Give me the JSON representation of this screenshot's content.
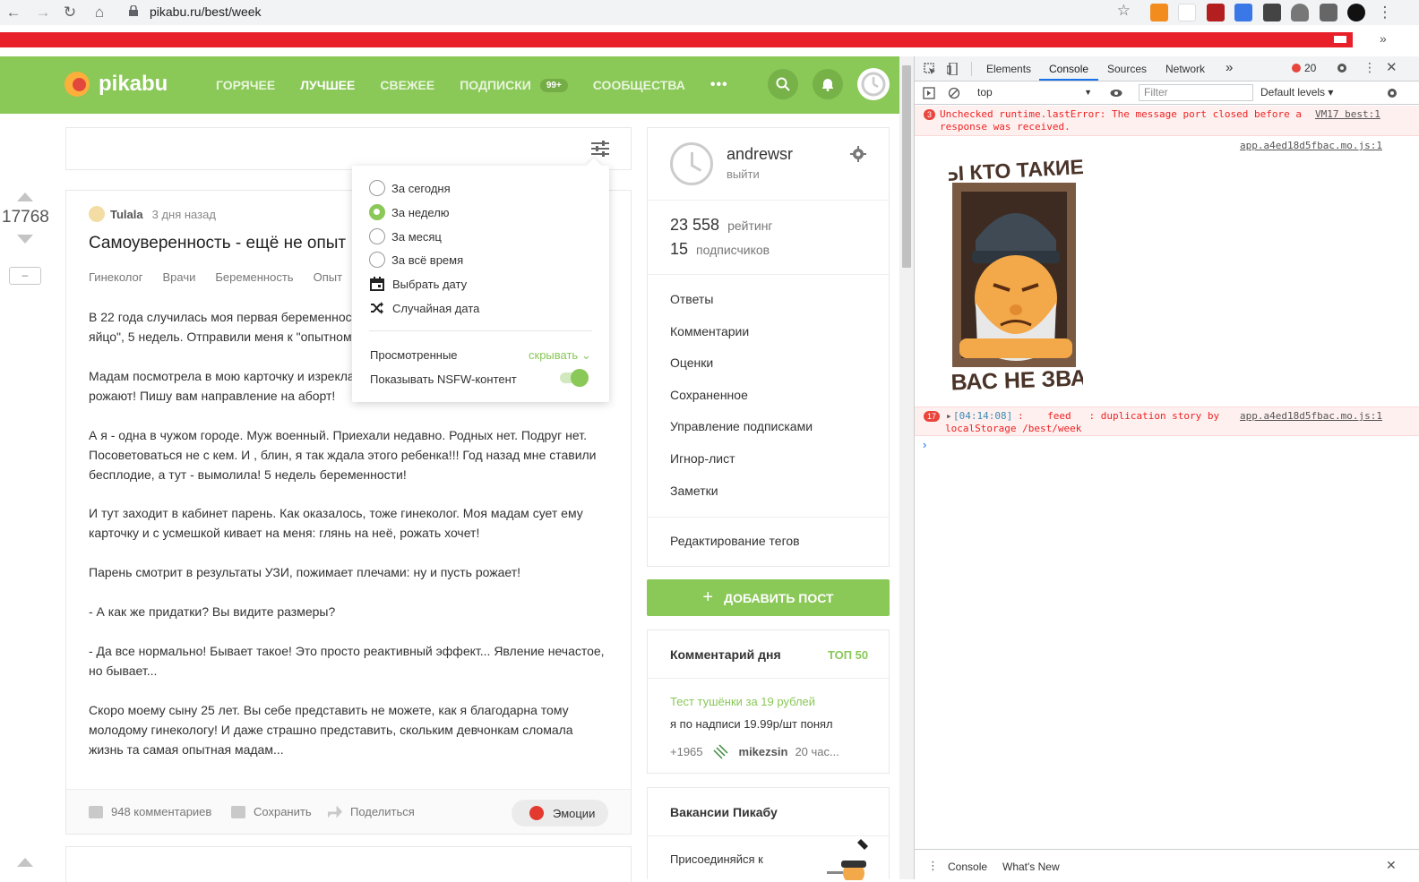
{
  "browser": {
    "url": "pikabu.ru/best/week"
  },
  "site": {
    "logo_text": "pikabu",
    "nav": [
      {
        "label": "ГОРЯЧЕЕ"
      },
      {
        "label": "ЛУЧШЕЕ"
      },
      {
        "label": "СВЕЖЕЕ"
      },
      {
        "label": "ПОДПИСКИ",
        "badge": "99+"
      },
      {
        "label": "СООБЩЕСТВА"
      }
    ],
    "nav_more": "•••"
  },
  "filter_menu": {
    "options": [
      {
        "label": "За сегодня",
        "selected": false
      },
      {
        "label": "За неделю",
        "selected": true
      },
      {
        "label": "За месяц",
        "selected": false
      },
      {
        "label": "За всё время",
        "selected": false
      }
    ],
    "pick_date": "Выбрать дату",
    "random_date": "Случайная дата",
    "viewed_label": "Просмотренные",
    "viewed_value": "скрывать",
    "nsfw_label": "Показывать NSFW-контент",
    "nsfw_on": true
  },
  "story": {
    "rating": "17768",
    "minus": "–",
    "author": "Tulala",
    "time": "3 дня назад",
    "title": "Самоуверенность - ещё не опыт",
    "tags": [
      "Гинеколог",
      "Врачи",
      "Беременность",
      "Опыт"
    ],
    "body": [
      "В 22 года случилась моя первая беременность. В заключении написали - \"плодное яйцо\", 5 недель. Отправили меня к \"опытному\" гинекологу.",
      "Мадам посмотрела в мою карточку и изрекла: С такими увеличенными придатками не рожают! Пишу вам направление на аборт!",
      "А я - одна в чужом городе. Муж военный. Приехали недавно.  Родных нет. Подруг нет. Посоветоваться не с кем. И , блин, я так ждала этого ребенка!!! Год назад мне ставили бесплодие, а тут - вымолила! 5 недель беременности!",
      "И тут заходит в кабинет парень. Как оказалось, тоже гинеколог. Моя мадам сует ему карточку и с усмешкой кивает на меня: глянь на неё, рожать хочет!",
      "Парень смотрит в результаты УЗИ, пожимает плечами: ну и пусть рожает!",
      "- А как же придатки? Вы видите размеры?",
      "- Да все нормально! Бывает такое! Это просто реактивный эффект... Явление нечастое, но бывает...",
      "Скоро моему сыну 25 лет. Вы себе представить не можете, как я благодарна тому молодому гинекологу! И даже страшно представить, скольким девчонкам сломала жизнь та самая опытная мадам..."
    ],
    "comments": "948 комментариев",
    "save": "Сохранить",
    "share": "Поделиться",
    "emotions": "Эмоции"
  },
  "profile": {
    "username": "andrewsr",
    "logout": "выйти",
    "rating_num": "23 558",
    "rating_label": "рейтинг",
    "subs_num": "15",
    "subs_label": "подписчиков",
    "links": [
      "Ответы",
      "Комментарии",
      "Оценки",
      "Сохраненное",
      "Управление подписками",
      "Игнор-лист",
      "Заметки"
    ],
    "edit_tags": "Редактирование тегов"
  },
  "add_post": "ДОБАВИТЬ ПОСТ",
  "comment_of_day": {
    "title": "Комментарий дня",
    "top": "ТОП 50",
    "post": "Тест тушёнки за 19 рублей",
    "text": "я по надписи 19.99р/шт понял",
    "score": "+1965",
    "user": "mikezsin",
    "time": "20 час..."
  },
  "vacancies": {
    "title": "Вакансии Пикабу",
    "text": "Присоединяйся к"
  },
  "devtools": {
    "tabs": [
      "Elements",
      "Console",
      "Sources",
      "Network"
    ],
    "more": "»",
    "error_count": "20",
    "context": "top",
    "filter_placeholder": "Filter",
    "levels": "Default levels",
    "messages": [
      {
        "count": "3",
        "text1": "Unchecked runtime.lastError: The message port closed before a",
        "text2": "response was received.",
        "source": "VM17 best:1"
      },
      {
        "source": "app.a4ed18d5fbac.mo.js:1"
      },
      {
        "count": "17",
        "time": "[04:14:08]",
        "text1": ":    feed   : duplication story by",
        "text2": "localStorage /best/week",
        "source": "app.a4ed18d5fbac.mo.js:1"
      }
    ],
    "sticker_top": "ВЫ КТО ТАКИЕ ?",
    "sticker_bottom": "Я ВАС НЕ ЗВАЛ",
    "drawer_tabs": [
      "Console",
      "What's New"
    ]
  }
}
